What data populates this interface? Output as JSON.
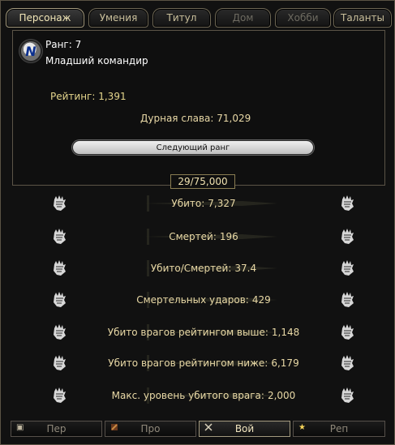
{
  "tabs": [
    {
      "label": "Персонаж",
      "state": "active"
    },
    {
      "label": "Умения",
      "state": "normal"
    },
    {
      "label": "Титул",
      "state": "normal"
    },
    {
      "label": "Дом",
      "state": "disabled"
    },
    {
      "label": "Хобби",
      "state": "disabled"
    },
    {
      "label": "Таланты",
      "state": "normal"
    }
  ],
  "rank": {
    "label": "Ранг:",
    "value": "7",
    "title": "Младший командир"
  },
  "rating": {
    "label": "Рейтинг:",
    "value": "1,391"
  },
  "infamy": {
    "label": "Дурная слава:",
    "value": "71,029"
  },
  "next_rank_button": "Следующий ранг",
  "progress_text": "29/75,000",
  "stats": [
    {
      "label": "Убито:",
      "value": "7,327"
    },
    {
      "label": "Смертей:",
      "value": "196"
    },
    {
      "label": "Убито/Смертей:",
      "value": "37.4"
    },
    {
      "label": "Смертельных ударов:",
      "value": "429"
    },
    {
      "label": "Убито врагов рейтингом выше:",
      "value": "1,148"
    },
    {
      "label": "Убито врагов рейтингом ниже:",
      "value": "6,179"
    },
    {
      "label": "Макс. уровень убитого врага:",
      "value": "2,000"
    }
  ],
  "bottom_tabs": [
    {
      "label": "Пер",
      "state": "normal",
      "icon": "character-icon"
    },
    {
      "label": "Про",
      "state": "normal",
      "icon": "profession-icon"
    },
    {
      "label": "Вой",
      "state": "active",
      "icon": "war-icon"
    },
    {
      "label": "Реп",
      "state": "normal",
      "icon": "reputation-star-icon"
    }
  ],
  "colors": {
    "text_main": "#e9d9a6",
    "rating_text": "#e4d58c",
    "border": "#5b5447",
    "background": "#111111"
  }
}
